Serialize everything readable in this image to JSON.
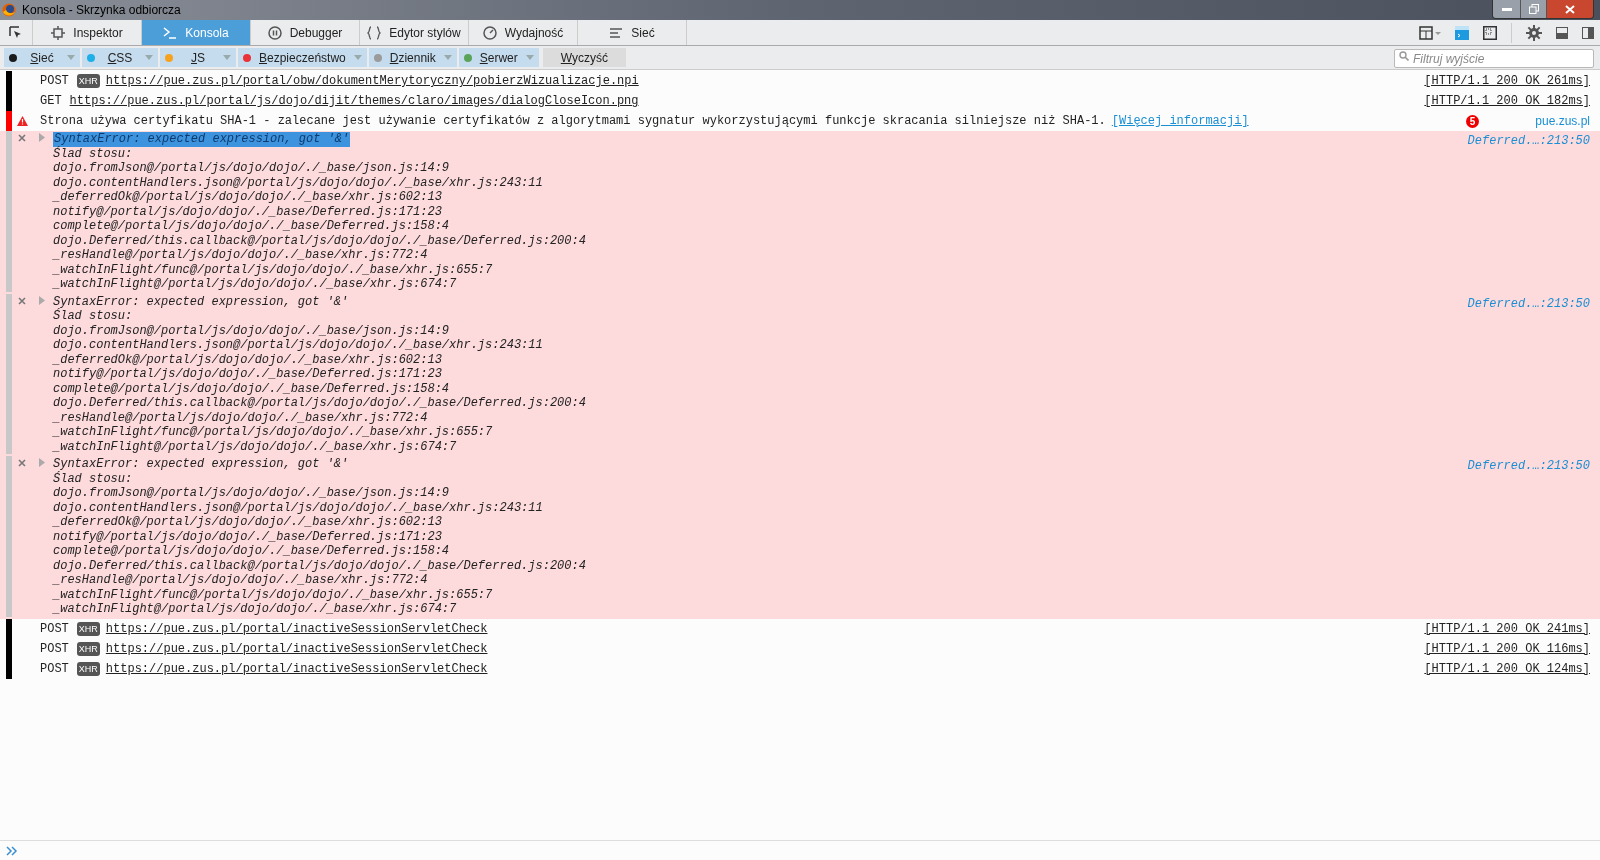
{
  "window": {
    "title": "Konsola - Skrzynka odbiorcza"
  },
  "tabs": [
    {
      "label": "Inspektor",
      "selected": false
    },
    {
      "label": "Konsola",
      "selected": true
    },
    {
      "label": "Debugger",
      "selected": false
    },
    {
      "label": "Edytor stylów",
      "selected": false
    },
    {
      "label": "Wydajność",
      "selected": false
    },
    {
      "label": "Sieć",
      "selected": false
    }
  ],
  "filters": [
    {
      "label": "Sieć",
      "color": "#1a1a1a",
      "selected": true
    },
    {
      "label": "CSS",
      "color": "#1eaee8",
      "selected": true
    },
    {
      "label": "JS",
      "color": "#f7a21e",
      "selected": true
    },
    {
      "label": "Bezpieczeństwo",
      "color": "#ea3338",
      "selected": true
    },
    {
      "label": "Dziennik",
      "color": "#9b9b9b",
      "selected": true
    },
    {
      "label": "Serwer",
      "color": "#5aa45a",
      "selected": true
    }
  ],
  "clear_button": "Wyczyść",
  "filter_field": {
    "placeholder": "Filtruj wyjście"
  },
  "messages": [
    {
      "kind": "request",
      "method": "POST",
      "xhr": "XHR",
      "url": "https://pue.zus.pl/portal/obw/dokumentMerytoryczny/pobierzWizualizacje.npi",
      "status": "[HTTP/1.1 200 OK 261ms]"
    },
    {
      "kind": "request",
      "method": "GET",
      "url": "https://pue.zus.pl/portal/js/dojo/dijit/themes/claro/images/dialogCloseIcon.png",
      "status": "[HTTP/1.1 200 OK 182ms]"
    },
    {
      "kind": "warning",
      "text": "Strona używa certyfikatu SHA-1 - zalecane jest używanie certyfikatów z algorytmami sygnatur wykorzystującymi funkcje skracania silniejsze niż SHA-1.",
      "link": "[Więcej informacji]",
      "count": "5",
      "source": "pue.zus.pl"
    },
    {
      "kind": "error",
      "text": "SyntaxError: expected expression, got '&'",
      "highlighted": true,
      "stack_title": "Ślad stosu:",
      "stack": [
        "dojo.fromJson@/portal/js/dojo/dojo/./_base/json.js:14:9",
        "dojo.contentHandlers.json@/portal/js/dojo/dojo/./_base/xhr.js:243:11",
        "_deferredOk@/portal/js/dojo/dojo/./_base/xhr.js:602:13",
        "notify@/portal/js/dojo/dojo/./_base/Deferred.js:171:23",
        "complete@/portal/js/dojo/dojo/./_base/Deferred.js:158:4",
        "dojo.Deferred/this.callback@/portal/js/dojo/dojo/./_base/Deferred.js:200:4",
        "_resHandle@/portal/js/dojo/dojo/./_base/xhr.js:772:4",
        "_watchInFlight/func@/portal/js/dojo/dojo/./_base/xhr.js:655:7",
        "_watchInFlight@/portal/js/dojo/dojo/./_base/xhr.js:674:7"
      ],
      "source": "Deferred.…:213:50"
    },
    {
      "kind": "error",
      "text": "SyntaxError: expected expression, got '&'",
      "highlighted": false,
      "stack_title": "Ślad stosu:",
      "stack": [
        "dojo.fromJson@/portal/js/dojo/dojo/./_base/json.js:14:9",
        "dojo.contentHandlers.json@/portal/js/dojo/dojo/./_base/xhr.js:243:11",
        "_deferredOk@/portal/js/dojo/dojo/./_base/xhr.js:602:13",
        "notify@/portal/js/dojo/dojo/./_base/Deferred.js:171:23",
        "complete@/portal/js/dojo/dojo/./_base/Deferred.js:158:4",
        "dojo.Deferred/this.callback@/portal/js/dojo/dojo/./_base/Deferred.js:200:4",
        "_resHandle@/portal/js/dojo/dojo/./_base/xhr.js:772:4",
        "_watchInFlight/func@/portal/js/dojo/dojo/./_base/xhr.js:655:7",
        "_watchInFlight@/portal/js/dojo/dojo/./_base/xhr.js:674:7"
      ],
      "source": "Deferred.…:213:50"
    },
    {
      "kind": "error",
      "text": "SyntaxError: expected expression, got '&'",
      "highlighted": false,
      "stack_title": "Ślad stosu:",
      "stack": [
        "dojo.fromJson@/portal/js/dojo/dojo/./_base/json.js:14:9",
        "dojo.contentHandlers.json@/portal/js/dojo/dojo/./_base/xhr.js:243:11",
        "_deferredOk@/portal/js/dojo/dojo/./_base/xhr.js:602:13",
        "notify@/portal/js/dojo/dojo/./_base/Deferred.js:171:23",
        "complete@/portal/js/dojo/dojo/./_base/Deferred.js:158:4",
        "dojo.Deferred/this.callback@/portal/js/dojo/dojo/./_base/Deferred.js:200:4",
        "_resHandle@/portal/js/dojo/dojo/./_base/xhr.js:772:4",
        "_watchInFlight/func@/portal/js/dojo/dojo/./_base/xhr.js:655:7",
        "_watchInFlight@/portal/js/dojo/dojo/./_base/xhr.js:674:7"
      ],
      "source": "Deferred.…:213:50"
    },
    {
      "kind": "request",
      "method": "POST",
      "xhr": "XHR",
      "url": "https://pue.zus.pl/portal/inactiveSessionServletCheck",
      "status": "[HTTP/1.1 200 OK 241ms]"
    },
    {
      "kind": "request",
      "method": "POST",
      "xhr": "XHR",
      "url": "https://pue.zus.pl/portal/inactiveSessionServletCheck",
      "status": "[HTTP/1.1 200 OK 116ms]"
    },
    {
      "kind": "request",
      "method": "POST",
      "xhr": "XHR",
      "url": "https://pue.zus.pl/portal/inactiveSessionServletCheck",
      "status": "[HTTP/1.1 200 OK 124ms]"
    }
  ]
}
